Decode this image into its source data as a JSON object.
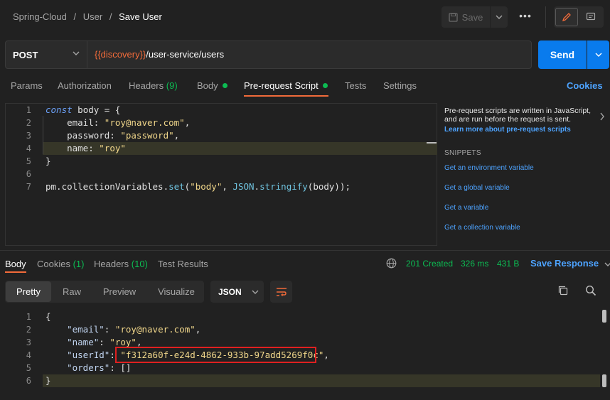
{
  "breadcrumb": {
    "collection": "Spring-Cloud",
    "folder": "User",
    "request": "Save User",
    "sep": "/"
  },
  "toolbar": {
    "save_label": "Save",
    "more": "•••"
  },
  "request": {
    "method": "POST",
    "url_var": "{{discovery}}",
    "url_path": "/user-service/users",
    "send_label": "Send"
  },
  "request_tabs": {
    "params": "Params",
    "authorization": "Authorization",
    "headers": "Headers",
    "headers_count": "(9)",
    "body": "Body",
    "prerequest": "Pre-request Script",
    "tests": "Tests",
    "settings": "Settings",
    "cookies": "Cookies"
  },
  "script": {
    "line_numbers": [
      "1",
      "2",
      "3",
      "4",
      "5",
      "6",
      "7"
    ],
    "l1_kw": "const",
    "l1_rest": " body = {",
    "l2_key": "    email: ",
    "l2_val": "\"roy@naver.com\"",
    "l2_end": ",",
    "l3_key": "    password: ",
    "l3_val": "\"password\"",
    "l3_end": ",",
    "l4_key": "    name: ",
    "l4_val": "\"roy\"",
    "l5": "}",
    "l7_a": "pm.collectionVariables.",
    "l7_fn": "set",
    "l7_b": "(",
    "l7_str": "\"body\"",
    "l7_c": ", ",
    "l7_json": "JSON",
    "l7_d": ".",
    "l7_fn2": "stringify",
    "l7_e": "(body));"
  },
  "side_panel": {
    "description": "Pre-request scripts are written in JavaScript, and are run before the request is sent.",
    "learn_more": "Learn more about pre-request scripts",
    "snippets_heading": "SNIPPETS",
    "snippets": [
      "Get an environment variable",
      "Get a global variable",
      "Get a variable",
      "Get a collection variable"
    ]
  },
  "response_tabs": {
    "body": "Body",
    "cookies": "Cookies",
    "cookies_count": "(1)",
    "headers": "Headers",
    "headers_count": "(10)",
    "test_results": "Test Results"
  },
  "response_status": {
    "status": "201 Created",
    "time": "326 ms",
    "size": "431 B",
    "save_response": "Save Response"
  },
  "format_tabs": {
    "pretty": "Pretty",
    "raw": "Raw",
    "preview": "Preview",
    "visualize": "Visualize",
    "format": "JSON"
  },
  "response_body": {
    "line_numbers": [
      "1",
      "2",
      "3",
      "4",
      "5",
      "6"
    ],
    "l1": "{",
    "email_key": "\"email\"",
    "email_val": "\"roy@naver.com\"",
    "name_key": "\"name\"",
    "name_val": "\"roy\"",
    "userId_key": "\"userId\"",
    "userId_val": "\"f312a60f-e24d-4862-933b-97add5269f0c\"",
    "orders_key": "\"orders\"",
    "orders_val": "[]",
    "l6": "}"
  },
  "colors": {
    "accent": "#f26b3a",
    "link": "#4da3ff",
    "success": "#0cbb52",
    "send": "#097bed",
    "highlight_box": "#e02020"
  }
}
